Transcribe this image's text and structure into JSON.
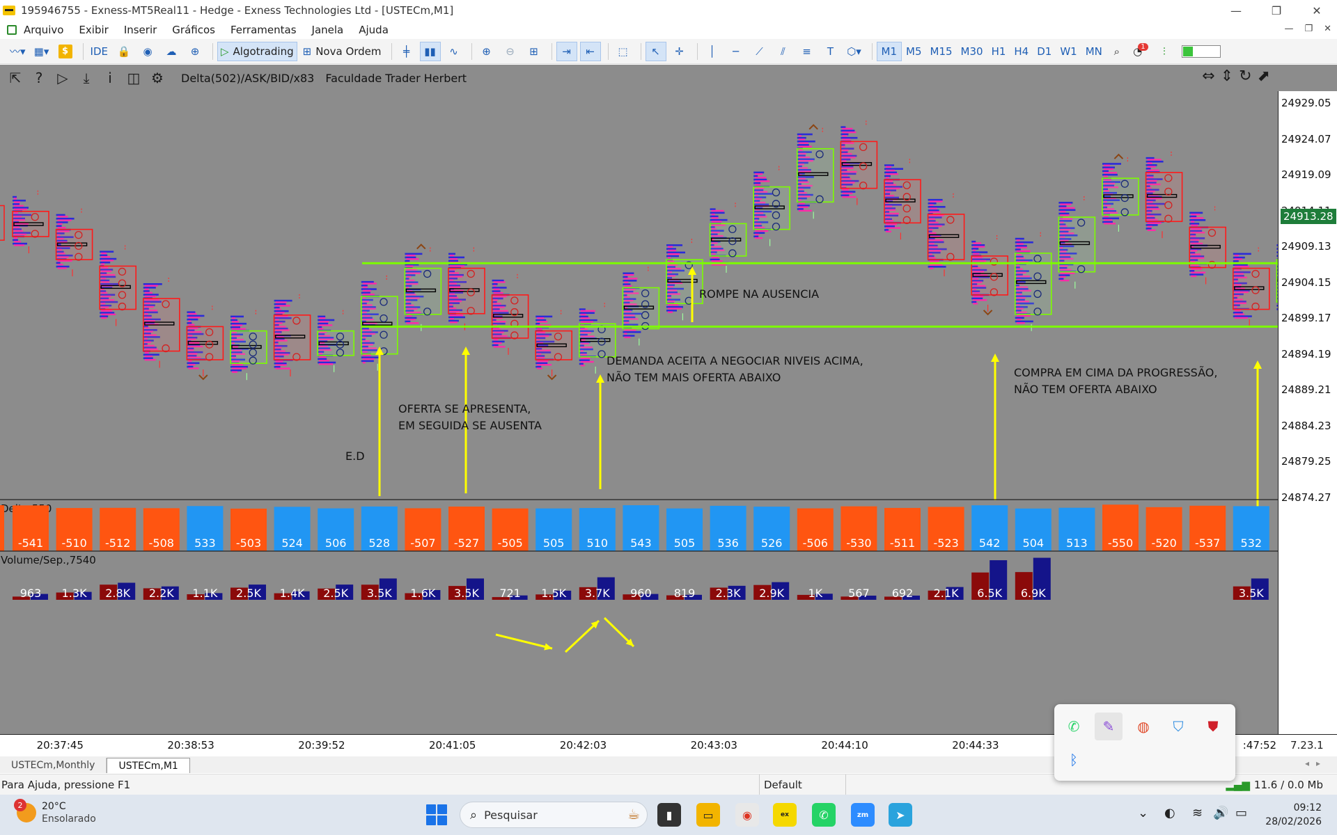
{
  "window": {
    "title": "195946755 - Exness-MT5Real11 - Hedge - Exness Technologies Ltd - [USTECm,M1]",
    "controls": [
      "—",
      "❐",
      "✕"
    ]
  },
  "menu": {
    "items": [
      "Arquivo",
      "Exibir",
      "Inserir",
      "Gráficos",
      "Ferramentas",
      "Janela",
      "Ajuda"
    ],
    "mdi": [
      "—",
      "❐",
      "✕"
    ]
  },
  "toolbar": {
    "ide": "IDE",
    "algotrading": "Algotrading",
    "nova_ordem": "Nova Ordem",
    "timeframes": [
      "M1",
      "M5",
      "M15",
      "M30",
      "H1",
      "H4",
      "D1",
      "W1",
      "MN"
    ],
    "active_timeframe": "M1",
    "notification_count": "1"
  },
  "chart": {
    "indicator_label": "Delta(502)/ASK/BID/x83",
    "watermark": "Faculdade Trader Herbert",
    "price_labels": [
      "24929.05",
      "24924.07",
      "24919.09",
      "24914.11",
      "24909.13",
      "24904.15",
      "24899.17",
      "24894.19",
      "24889.21",
      "24884.23",
      "24879.25",
      "24874.27"
    ],
    "current_price": "24913.28",
    "time_labels": [
      "20:37:45",
      "20:38:53",
      "20:39:52",
      "20:41:05",
      "20:42:03",
      "20:43:03",
      "20:44:10",
      "20:44:33",
      ":47:52"
    ],
    "time_right": "7.23.1",
    "annotations": {
      "rompe": "ROMPE NA AUSENCIA",
      "demanda1": "DEMANDA ACEITA A NEGOCIAR NIVEIS ACIMA,",
      "demanda2": "NÃO TEM MAIS OFERTA ABAIXO",
      "compra1": "COMPRA EM CIMA DA PROGRESSÃO,",
      "compra2": "NÃO TEM OFERTA ABAIXO",
      "oferta1": "OFERTA SE APRESENTA,",
      "oferta2": "EM SEGUIDA SE AUSENTA",
      "ed": "E.D"
    },
    "delta_panel_label": "Delta,550",
    "volume_panel_label": "Volume/Sep.,7540",
    "colors": {
      "background": "#8c8c8c",
      "level_line": "#7cfc00",
      "buy_box": "#7cfc00",
      "sell_box": "#ff1a1a",
      "delta_positive": "#2196f3",
      "delta_negative": "#ff5511",
      "arrow": "#ffff00"
    }
  },
  "chart_data": {
    "type": "bar",
    "title": "",
    "delta": {
      "label": "Delta,550",
      "values": [
        -541,
        -510,
        -512,
        -508,
        533,
        -503,
        524,
        506,
        528,
        -507,
        -527,
        -505,
        505,
        510,
        543,
        505,
        536,
        526,
        -506,
        -530,
        -511,
        -523,
        542,
        504,
        513,
        -550,
        -520,
        -537,
        532
      ],
      "display": [
        "-541",
        "-510",
        "-512",
        "-508",
        "533",
        "-503",
        "524",
        "506",
        "528",
        "-507",
        "-527",
        "-505",
        "505",
        "510",
        "543",
        "505",
        "536",
        "526",
        "-506",
        "-530",
        "-511",
        "-523",
        "542",
        "504",
        "513",
        "-550",
        "-520",
        "-537",
        "532"
      ]
    },
    "volume": {
      "label": "Volume/Sep.,7540",
      "values": [
        963,
        1300,
        2800,
        2200,
        1100,
        2500,
        1400,
        2500,
        3500,
        1600,
        3500,
        721,
        1500,
        3700,
        960,
        819,
        2300,
        2900,
        1000,
        567,
        692,
        2100,
        6500,
        6900,
        3500
      ],
      "display": [
        "963",
        "1.3K",
        "2.8K",
        "2.2K",
        "1.1K",
        "2.5K",
        "1.4K",
        "2.5K",
        "3.5K",
        "1.6K",
        "3.5K",
        "721",
        "1.5K",
        "3.7K",
        "960",
        "819",
        "2.3K",
        "2.9K",
        "1K",
        "567",
        "692",
        "2.1K",
        "6.5K",
        "6.9K",
        "3.5K"
      ],
      "columns": [
        1,
        2,
        3,
        4,
        5,
        6,
        7,
        8,
        9,
        10,
        11,
        12,
        13,
        14,
        15,
        16,
        17,
        18,
        19,
        20,
        21,
        22,
        23,
        24,
        29
      ]
    },
    "candles": {
      "direction": [
        "sell",
        "sell",
        "sell",
        "sell",
        "sell",
        "buy",
        "sell",
        "buy",
        "buy",
        "buy",
        "sell",
        "sell",
        "sell",
        "buy",
        "buy",
        "buy",
        "buy",
        "buy",
        "buy",
        "sell",
        "sell",
        "sell",
        "sell",
        "buy",
        "buy",
        "buy",
        "sell",
        "sell",
        "sell",
        "buy"
      ],
      "box_high": [
        24914.0,
        24911.5,
        24906.4,
        24901.9,
        24898.0,
        24897.4,
        24899.6,
        24897.4,
        24902.2,
        24906.1,
        24906.1,
        24902.4,
        24897.4,
        24898.4,
        24903.4,
        24907.3,
        24912.3,
        24917.4,
        24922.7,
        24923.7,
        24918.4,
        24913.6,
        24907.8,
        24908.2,
        24913.2,
        24918.6,
        24919.4,
        24911.8,
        24906.1,
        24907.3
      ],
      "box_low": [
        24910.5,
        24907.3,
        24900.4,
        24894.6,
        24893.4,
        24892.9,
        24893.4,
        24894.0,
        24894.2,
        24899.7,
        24899.8,
        24896.4,
        24893.4,
        24893.8,
        24897.7,
        24901.2,
        24907.8,
        24911.5,
        24915.3,
        24917.2,
        24912.4,
        24907.3,
        24902.4,
        24899.7,
        24905.6,
        24913.5,
        24912.6,
        24906.2,
        24900.4,
        24901.4
      ]
    },
    "levels": [
      24906.8,
      24898.0
    ],
    "ylim": [
      24874.27,
      24929.05
    ]
  },
  "tabs": [
    "USTECm,Monthly",
    "USTECm,M1"
  ],
  "active_tab": "USTECm,M1",
  "status": {
    "help": "Para Ajuda, pressione F1",
    "profile": "Default",
    "net": "11.6 / 0.0 Mb"
  },
  "taskbar": {
    "temp": "20°C",
    "weather": "Ensolarado",
    "weather_badge": "2",
    "search_placeholder": "Pesquisar",
    "time": "09:12",
    "date": "28/02/2026"
  }
}
